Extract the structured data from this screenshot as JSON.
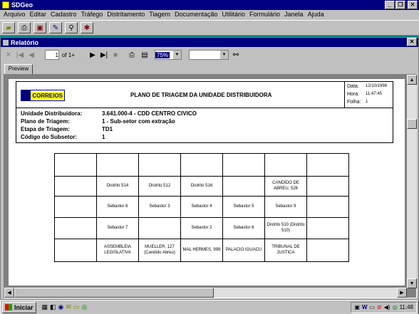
{
  "app": {
    "title": "SDGeo"
  },
  "menu": [
    "Arquivo",
    "Editar",
    "Cadastro",
    "Tráfego",
    "Distritamento",
    "Tiagem",
    "Documentação",
    "Utilitário",
    "Formulário",
    "Janela",
    "Ajuda"
  ],
  "window": {
    "title": "Relatório"
  },
  "nav": {
    "page_value": "1",
    "page_of": "of 1+",
    "zoom": "75%",
    "search_value": ""
  },
  "tabs": {
    "preview": "Preview"
  },
  "report": {
    "logo": "CORREIOS",
    "title": "PLANO DE TRIAGEM DA UNIDADE DISTRIBUIDORA",
    "meta": [
      {
        "label": "Data:",
        "value": "12/10/1998"
      },
      {
        "label": "Hora:",
        "value": "11:47:45"
      },
      {
        "label": "Folha:",
        "value": "1"
      }
    ],
    "fields": [
      {
        "label": "Unidade Distribuidora:",
        "value": "3.641.000-4 - CDD CENTRO CIVICO"
      },
      {
        "label": "Plano de Triagem:",
        "value": "1 - Sub-setor com extração"
      },
      {
        "label": "Etapa de Triagem:",
        "value": "TD1"
      },
      {
        "label": "Código do Subsetor:",
        "value": "1"
      }
    ],
    "grid": [
      [
        "",
        "",
        "",
        "",
        "",
        "",
        ""
      ],
      [
        "",
        "Distrito 514",
        "Distrito 512",
        "Distrito 516",
        "",
        "CANDIDO DE ABREU, 526",
        ""
      ],
      [
        "",
        "Sebastor 6",
        "Sebastor 3",
        "Sebastor 4",
        "Sebastor 5",
        "Sebastor 9",
        ""
      ],
      [
        "",
        "Sebastor 7",
        "",
        "Sebastor 2",
        "Sebastor 8",
        "Distrito 510 (Distrito 510)",
        ""
      ],
      [
        "",
        "ASSEMBLEIA LEGISLATIVA",
        "MUELLER, 127 (Candido Abreu)",
        "MAL HERMES, 999",
        "PALACIO IGUACU",
        "TRIBUNAL DE JUSTICA",
        ""
      ]
    ]
  },
  "taskbar": {
    "start": "Iniciar",
    "clock": "11:48"
  }
}
